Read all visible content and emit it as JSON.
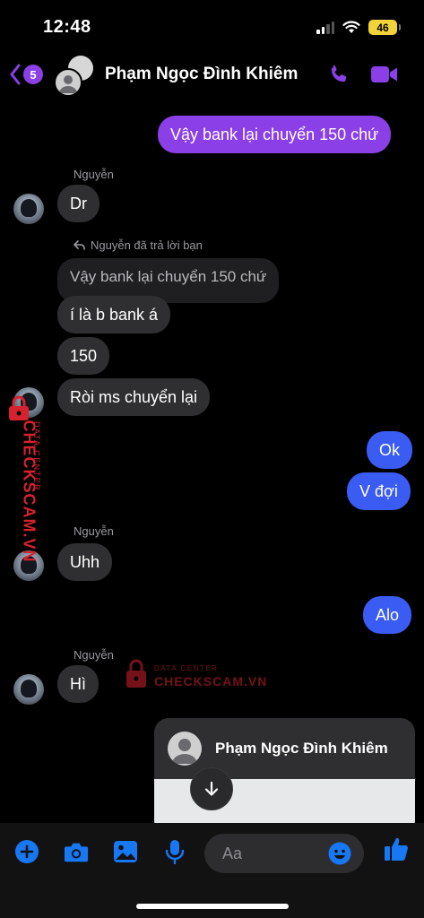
{
  "status_bar": {
    "time": "12:48",
    "battery": "46"
  },
  "header": {
    "unread_count": "5",
    "contact_name": "Phạm Ngọc Đình Khiêm"
  },
  "messages": {
    "m1": "Vậy bank lại chuyển 150 chứ",
    "sender1": "Nguyễn",
    "m2": "Dr",
    "reply_note": "Nguyễn đã trả lời bạn",
    "quoted": "Vậy bank lại chuyển 150 chứ",
    "m3": "í là b bank á",
    "m4": "150",
    "m5": "Ròi ms chuyển lại",
    "m6": "Ok",
    "m7": "V đợi",
    "sender2": "Nguyễn",
    "m8": "Uhh",
    "m9": "Alo",
    "sender3": "Nguyễn",
    "m10": "Hì"
  },
  "card": {
    "name": "Phạm Ngọc Đình Khiêm"
  },
  "composer": {
    "placeholder": "Aa"
  },
  "watermark": {
    "small": "DATA CENTER",
    "big": "CHECKSCAM.VN"
  },
  "colors": {
    "accent": "#8b3fe6",
    "sent_purple": "#8b3fe6",
    "sent_blue": "#3b5cf2",
    "received": "#2f2f31",
    "icon_blue": "#1877f2",
    "watermark_red": "#d6222e"
  },
  "icons": [
    "chevron-left-icon",
    "phone-icon",
    "video-camera-icon",
    "reply-arrow-icon",
    "arrow-down-icon",
    "plus-icon",
    "camera-icon",
    "image-icon",
    "microphone-icon",
    "emoji-icon",
    "thumbs-up-icon"
  ]
}
